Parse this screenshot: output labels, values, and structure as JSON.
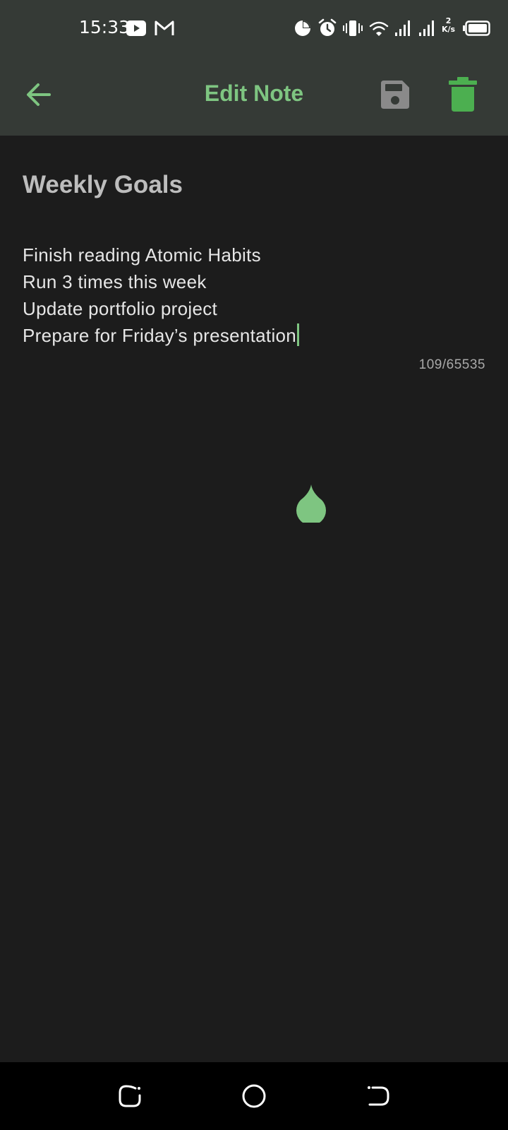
{
  "status_bar": {
    "time": "15:33",
    "net_speed_value": "2",
    "net_speed_unit": "K/s",
    "icons": [
      "youtube-icon",
      "gmail-icon",
      "data-saver-icon",
      "alarm-icon",
      "vibrate-icon",
      "wifi-icon",
      "signal-icon",
      "signal-icon",
      "battery-icon"
    ]
  },
  "app_bar": {
    "title": "Edit Note",
    "icons": [
      "back-arrow-icon",
      "save-icon",
      "delete-icon"
    ]
  },
  "note": {
    "title": "Weekly Goals",
    "lines": [
      "Finish reading Atomic Habits",
      "Run 3 times this week",
      "Update portfolio project",
      "Prepare for Friday’s presentation"
    ],
    "char_count": "109/65535"
  },
  "nav_bar": {
    "icons": [
      "recents-icon",
      "home-icon",
      "back-icon"
    ]
  },
  "colors": {
    "app_bar_bg": "#353a36",
    "content_bg": "#1c1c1c",
    "accent": "#7ec581",
    "delete": "#4caf50",
    "save_disabled": "#8a8a8a",
    "title_text": "#bdbdbd",
    "body_text": "#e6e6e6"
  }
}
